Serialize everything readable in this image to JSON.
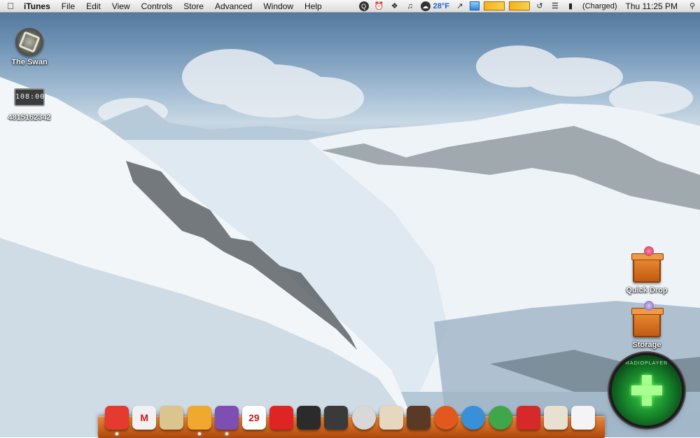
{
  "menubar": {
    "apple_icon": "apple-logo-icon",
    "app_name": "iTunes",
    "menus": [
      "File",
      "Edit",
      "View",
      "Controls",
      "Store",
      "Advanced",
      "Window",
      "Help"
    ],
    "status": {
      "temperature": "28°F",
      "battery_status": "(Charged)",
      "clock": "Thu 11:25 PM"
    }
  },
  "desktop": {
    "icons_left": [
      {
        "name": "the-swan",
        "label": "The Swan",
        "icon": "dharma-swan-icon"
      },
      {
        "name": "counter",
        "label": "4815162342",
        "icon": "countdown-clock-icon",
        "display": "108:00"
      }
    ],
    "icons_right": [
      {
        "name": "quick-drop",
        "label": "Quick Drop",
        "icon": "orange-box-icon"
      },
      {
        "name": "storage",
        "label": "Storage",
        "icon": "orange-box-icon"
      }
    ],
    "widget": {
      "arc_text": "RADIOPLAYER",
      "icon": "green-orb-radio-icon"
    }
  },
  "dock": {
    "items": [
      {
        "name": "finder",
        "icon": "rainbow-apple-icon",
        "color": "#e43a2f",
        "glyph": "",
        "running": true
      },
      {
        "name": "mail",
        "icon": "gmail-envelope-icon",
        "color": "#f1f1f1",
        "glyph": "M",
        "running": false
      },
      {
        "name": "safari",
        "icon": "safari-hat-icon",
        "color": "#d9c58d",
        "glyph": "",
        "running": false
      },
      {
        "name": "adium",
        "icon": "duck-icon",
        "color": "#f2a72e",
        "glyph": "",
        "running": true
      },
      {
        "name": "itunes",
        "icon": "headphones-icon",
        "color": "#7d4fb3",
        "glyph": "",
        "running": true
      },
      {
        "name": "ical",
        "icon": "calendar-icon",
        "color": "#ffffff",
        "glyph": "29",
        "running": false
      },
      {
        "name": "photo-booth",
        "icon": "red-monster-icon",
        "color": "#e02323",
        "glyph": "",
        "running": false
      },
      {
        "name": "camera",
        "icon": "camera-icon",
        "color": "#2b2b2b",
        "glyph": "",
        "running": false
      },
      {
        "name": "dvd-player",
        "icon": "film-reel-icon",
        "color": "#3a3a3a",
        "glyph": "",
        "running": false
      },
      {
        "name": "disk-utility",
        "icon": "disc-icon",
        "color": "#d8d8d8",
        "glyph": "",
        "running": false
      },
      {
        "name": "coffee",
        "icon": "coffee-cup-icon",
        "color": "#e7d7bf",
        "glyph": "",
        "running": false
      },
      {
        "name": "dashboard",
        "icon": "grid-board-icon",
        "color": "#5a3a24",
        "glyph": "",
        "running": false
      },
      {
        "name": "ubuntu",
        "icon": "ubuntu-logo-icon",
        "color": "#e1591f",
        "glyph": "",
        "running": false
      },
      {
        "name": "windows",
        "icon": "windows-logo-icon",
        "color": "#3a8fd9",
        "glyph": "",
        "running": false
      },
      {
        "name": "xbox",
        "icon": "xbox-logo-icon",
        "color": "#3fa64a",
        "glyph": "",
        "running": false
      },
      {
        "name": "nike",
        "icon": "nike-box-icon",
        "color": "#d62a2a",
        "glyph": "",
        "running": false
      },
      {
        "name": "reebok",
        "icon": "reebok-box-icon",
        "color": "#e8e0d0",
        "glyph": "",
        "running": false
      },
      {
        "name": "starbucks",
        "icon": "starbucks-cup-icon",
        "color": "#f4f4f4",
        "glyph": "",
        "running": false
      }
    ]
  }
}
